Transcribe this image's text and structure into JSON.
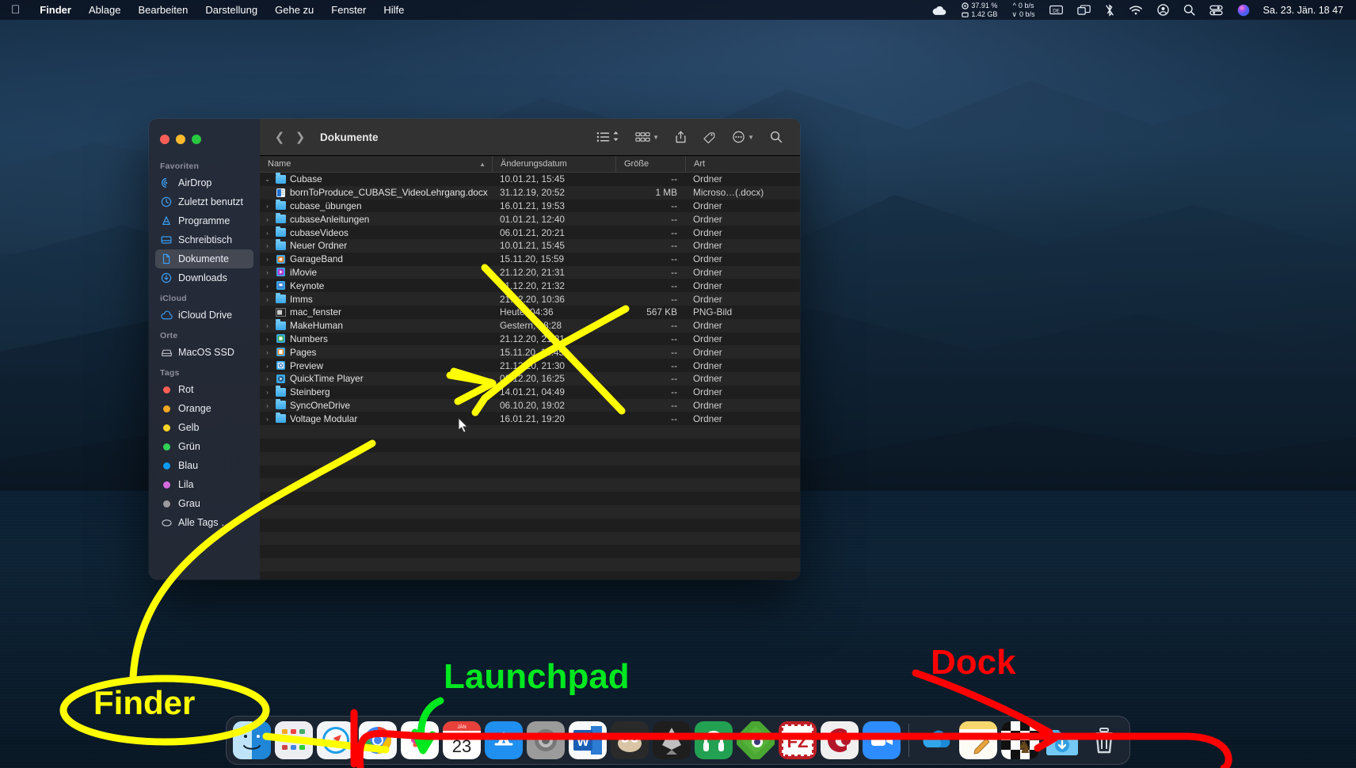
{
  "menubar": {
    "apple_icon": "apple-logo",
    "items": [
      {
        "label": "Finder",
        "bold": true
      },
      {
        "label": "Ablage",
        "bold": false
      },
      {
        "label": "Bearbeiten",
        "bold": false
      },
      {
        "label": "Darstellung",
        "bold": false
      },
      {
        "label": "Gehe zu",
        "bold": false
      },
      {
        "label": "Fenster",
        "bold": false
      },
      {
        "label": "Hilfe",
        "bold": false
      }
    ],
    "status": {
      "cloud_icon": "icloud-icon",
      "cpu_value": "37.91 %",
      "mem_value": "1.42 GB",
      "net_up": "0 b/s",
      "net_down": "0 b/s",
      "icons": [
        "keyboard-input-icon",
        "screen-mirroring-icon",
        "bluetooth-icon",
        "wifi-icon",
        "user-account-icon",
        "spotlight-search-icon",
        "control-center-icon",
        "siri-icon"
      ],
      "datetime": "Sa. 23. Jän.  18 47"
    }
  },
  "finder": {
    "title": "Dokumente",
    "traffic_lights": [
      "close-button",
      "minimize-button",
      "zoom-button"
    ],
    "toolbar": {
      "back_icon": "chevron-left-icon",
      "forward_icon": "chevron-right-icon",
      "view_list_icon": "list-view-icon",
      "group_icon": "group-by-icon",
      "arrange_icon": "arrange-icon",
      "share_icon": "share-icon",
      "tag_icon": "tag-icon",
      "more_icon": "more-actions-icon",
      "search_icon": "search-icon"
    },
    "sidebar": {
      "sections": [
        {
          "title": "Favoriten",
          "items": [
            {
              "label": "AirDrop",
              "icon": "airdrop-icon",
              "selected": false
            },
            {
              "label": "Zuletzt benutzt",
              "icon": "recents-clock-icon",
              "selected": false
            },
            {
              "label": "Programme",
              "icon": "applications-icon",
              "selected": false
            },
            {
              "label": "Schreibtisch",
              "icon": "desktop-icon",
              "selected": false
            },
            {
              "label": "Dokumente",
              "icon": "documents-icon",
              "selected": true
            },
            {
              "label": "Downloads",
              "icon": "downloads-icon",
              "selected": false
            }
          ]
        },
        {
          "title": "iCloud",
          "items": [
            {
              "label": "iCloud Drive",
              "icon": "icloud-drive-icon",
              "selected": false
            }
          ]
        },
        {
          "title": "Orte",
          "items": [
            {
              "label": "MacOS SSD",
              "icon": "hard-disk-icon",
              "selected": false
            }
          ]
        },
        {
          "title": "Tags",
          "items": [
            {
              "label": "Rot",
              "icon": "tag-dot-icon",
              "color": "#ff5f52",
              "selected": false
            },
            {
              "label": "Orange",
              "icon": "tag-dot-icon",
              "color": "#f5a623",
              "selected": false
            },
            {
              "label": "Gelb",
              "icon": "tag-dot-icon",
              "color": "#ffd426",
              "selected": false
            },
            {
              "label": "Grün",
              "icon": "tag-dot-icon",
              "color": "#30d158",
              "selected": false
            },
            {
              "label": "Blau",
              "icon": "tag-dot-icon",
              "color": "#0a9bf5",
              "selected": false
            },
            {
              "label": "Lila",
              "icon": "tag-dot-icon",
              "color": "#d86ae0",
              "selected": false
            },
            {
              "label": "Grau",
              "icon": "tag-dot-icon",
              "color": "#9b9b9f",
              "selected": false
            },
            {
              "label": "Alle Tags …",
              "icon": "all-tags-icon",
              "color": "",
              "selected": false
            }
          ]
        }
      ]
    },
    "columns": [
      "Name",
      "Änderungsdatum",
      "Größe",
      "Art"
    ],
    "sort_indicator": "ascending-caret",
    "rows": [
      {
        "name": "Cubase",
        "date": "10.01.21, 15:45",
        "size": "--",
        "art": "Ordner",
        "indent": 0,
        "twisty": "open",
        "icon": "folder-icon"
      },
      {
        "name": "bornToProduce_CUBASE_VideoLehrgang.docx",
        "date": "31.12.19, 20:52",
        "size": "1 MB",
        "art": "Microso…(.docx)",
        "indent": 2,
        "twisty": "",
        "icon": "word-doc-icon"
      },
      {
        "name": "cubase_übungen",
        "date": "16.01.21, 19:53",
        "size": "--",
        "art": "Ordner",
        "indent": 1,
        "twisty": "closed",
        "icon": "folder-icon"
      },
      {
        "name": "cubaseAnleitungen",
        "date": "01.01.21, 12:40",
        "size": "--",
        "art": "Ordner",
        "indent": 1,
        "twisty": "closed",
        "icon": "folder-icon"
      },
      {
        "name": "cubaseVideos",
        "date": "06.01.21, 20:21",
        "size": "--",
        "art": "Ordner",
        "indent": 1,
        "twisty": "closed",
        "icon": "folder-icon"
      },
      {
        "name": "Neuer Ordner",
        "date": "10.01.21, 15:45",
        "size": "--",
        "art": "Ordner",
        "indent": 1,
        "twisty": "closed",
        "icon": "folder-icon"
      },
      {
        "name": "GarageBand",
        "date": "15.11.20, 15:59",
        "size": "--",
        "art": "Ordner",
        "indent": 0,
        "twisty": "closed",
        "icon": "garageband-folder-icon"
      },
      {
        "name": "iMovie",
        "date": "21.12.20, 21:31",
        "size": "--",
        "art": "Ordner",
        "indent": 0,
        "twisty": "closed",
        "icon": "imovie-folder-icon"
      },
      {
        "name": "Keynote",
        "date": "21.12.20, 21:32",
        "size": "--",
        "art": "Ordner",
        "indent": 0,
        "twisty": "closed",
        "icon": "keynote-folder-icon"
      },
      {
        "name": "Imms",
        "date": "21.12.20, 10:36",
        "size": "--",
        "art": "Ordner",
        "indent": 0,
        "twisty": "closed",
        "icon": "folder-icon"
      },
      {
        "name": "mac_fenster",
        "date": "Heute, 04:36",
        "size": "567 KB",
        "art": "PNG-Bild",
        "indent": 0,
        "twisty": "",
        "icon": "png-image-icon"
      },
      {
        "name": "MakeHuman",
        "date": "Gestern, 08:28",
        "size": "--",
        "art": "Ordner",
        "indent": 0,
        "twisty": "closed",
        "icon": "folder-icon"
      },
      {
        "name": "Numbers",
        "date": "21.12.20, 21:31",
        "size": "--",
        "art": "Ordner",
        "indent": 0,
        "twisty": "closed",
        "icon": "numbers-folder-icon"
      },
      {
        "name": "Pages",
        "date": "15.11.20, 16:45",
        "size": "--",
        "art": "Ordner",
        "indent": 0,
        "twisty": "closed",
        "icon": "pages-folder-icon"
      },
      {
        "name": "Preview",
        "date": "21.12.20, 21:30",
        "size": "--",
        "art": "Ordner",
        "indent": 0,
        "twisty": "closed",
        "icon": "preview-folder-icon"
      },
      {
        "name": "QuickTime Player",
        "date": "06.12.20, 16:25",
        "size": "--",
        "art": "Ordner",
        "indent": 0,
        "twisty": "closed",
        "icon": "quicktime-folder-icon"
      },
      {
        "name": "Steinberg",
        "date": "14.01.21, 04:49",
        "size": "--",
        "art": "Ordner",
        "indent": 0,
        "twisty": "closed",
        "icon": "folder-icon"
      },
      {
        "name": "SyncOneDrive",
        "date": "06.10.20, 19:02",
        "size": "--",
        "art": "Ordner",
        "indent": 0,
        "twisty": "closed",
        "icon": "folder-icon"
      },
      {
        "name": "Voltage Modular",
        "date": "16.01.21, 19:20",
        "size": "--",
        "art": "Ordner",
        "indent": 0,
        "twisty": "closed",
        "icon": "folder-icon"
      }
    ]
  },
  "dock": {
    "items": [
      {
        "name": "finder",
        "label": "Finder",
        "running": true
      },
      {
        "name": "launchpad",
        "label": "Launchpad",
        "running": false
      },
      {
        "name": "safari",
        "label": "Safari",
        "running": false
      },
      {
        "name": "chrome",
        "label": "Google Chrome",
        "running": false
      },
      {
        "name": "photos",
        "label": "Fotos",
        "running": false
      },
      {
        "name": "calendar",
        "label": "Kalender",
        "running": false,
        "badge_month": "JÄN",
        "badge_day": "23"
      },
      {
        "name": "app-store",
        "label": "App Store",
        "running": false
      },
      {
        "name": "system-prefs",
        "label": "Systemeinstellungen",
        "running": false
      },
      {
        "name": "word",
        "label": "Microsoft Word",
        "running": false
      },
      {
        "name": "gimp",
        "label": "GIMP",
        "running": false
      },
      {
        "name": "inkscape",
        "label": "Inkscape",
        "running": false
      },
      {
        "name": "audacity",
        "label": "Audacity",
        "running": false
      },
      {
        "name": "blender",
        "label": "Blender",
        "running": false
      },
      {
        "name": "filezilla",
        "label": "FileZilla",
        "running": false
      },
      {
        "name": "cubase",
        "label": "Cubase",
        "running": false
      },
      {
        "name": "zoom",
        "label": "Zoom",
        "running": false
      }
    ],
    "items_right": [
      {
        "name": "onedrive",
        "label": "OneDrive",
        "running": false
      },
      {
        "name": "notes",
        "label": "Notizen",
        "running": true
      },
      {
        "name": "chess",
        "label": "Schach",
        "running": false
      },
      {
        "name": "downloads-stack",
        "label": "Downloads",
        "running": false
      },
      {
        "name": "trash",
        "label": "Papierkorb",
        "running": false
      }
    ]
  },
  "annotations": [
    {
      "id": "finder",
      "text": "Finder",
      "color": "#ffff00"
    },
    {
      "id": "launchpad",
      "text": "Launchpad",
      "color": "#00e81f"
    },
    {
      "id": "dock",
      "text": "Dock",
      "color": "#ff0000"
    }
  ],
  "cursor": {
    "icon": "mouse-pointer-icon"
  }
}
